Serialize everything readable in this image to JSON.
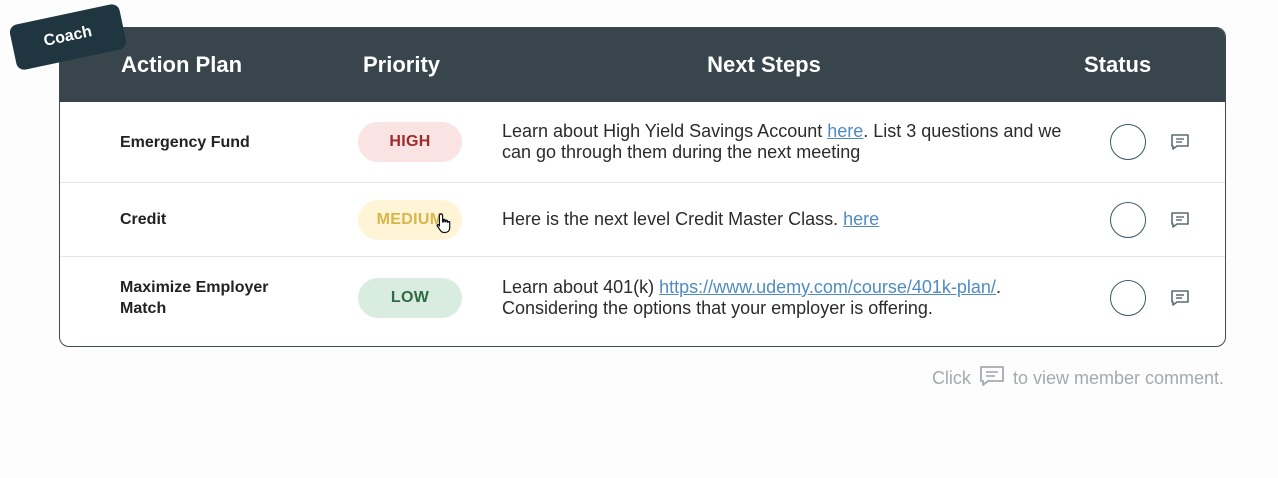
{
  "badge": {
    "label": "Coach"
  },
  "table": {
    "headers": {
      "action_plan": "Action Plan",
      "priority": "Priority",
      "next_steps": "Next Steps",
      "status": "Status"
    },
    "rows": [
      {
        "name": "Emergency Fund",
        "priority": "HIGH",
        "steps_before": "Learn about High Yield Savings Account ",
        "link": "here",
        "steps_after": ". List 3 questions and we can go through them during the next meeting"
      },
      {
        "name": "Credit",
        "priority": "MEDIUM",
        "steps_before": "Here is the next level Credit Master Class. ",
        "link": "here",
        "steps_after": ""
      },
      {
        "name": "Maximize Employer Match",
        "priority": "LOW",
        "steps_before": "Learn about 401(k) ",
        "link": "https://www.udemy.com/course/401k-plan/",
        "steps_after": ". Considering the options that your employer is offering."
      }
    ]
  },
  "footer": {
    "before": "Click",
    "after": "to view member comment."
  },
  "colors": {
    "header_bg": "#38454d",
    "high": "#a12a2a",
    "medium": "#d8b64a",
    "low": "#2f6b43",
    "link": "#4e8cc2"
  }
}
